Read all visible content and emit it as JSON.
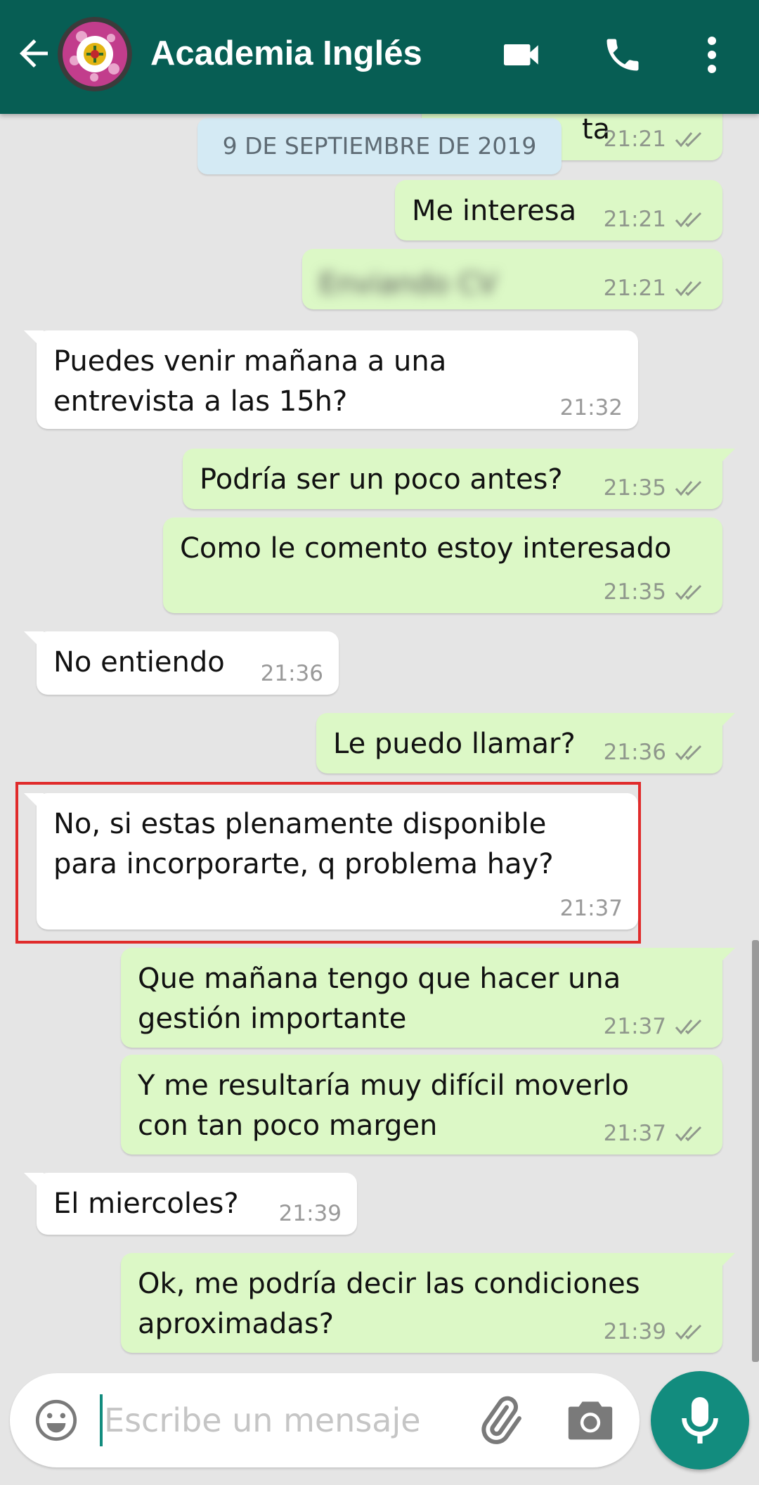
{
  "header": {
    "title": "Academia Inglés",
    "avatar_icon": "academy-logo-icon",
    "background_color": "#075e54"
  },
  "date_chip": "9 DE SEPTIEMBRE DE 2019",
  "messages": [
    {
      "direction": "out",
      "text": "ta",
      "time": "21:21",
      "status": "read"
    },
    {
      "direction": "out",
      "text": "Me interesa",
      "time": "21:21",
      "status": "read"
    },
    {
      "direction": "out",
      "text": "Enviando CV",
      "time": "21:21",
      "status": "read",
      "blurred": true
    },
    {
      "direction": "in",
      "lines": [
        "Puedes venir mañana a una",
        "entrevista a las 15h?"
      ],
      "time": "21:32"
    },
    {
      "direction": "out",
      "text": "Podría ser un poco antes?",
      "time": "21:35",
      "status": "read"
    },
    {
      "direction": "out",
      "text": "Como le comento estoy interesado",
      "time": "21:35",
      "status": "read"
    },
    {
      "direction": "in",
      "text": "No entiendo",
      "time": "21:36"
    },
    {
      "direction": "out",
      "text": "Le puedo llamar?",
      "time": "21:36",
      "status": "read"
    },
    {
      "direction": "in",
      "lines": [
        "No, si estas plenamente disponible",
        "para incorporarte, q problema hay?"
      ],
      "time": "21:37",
      "highlighted": true
    },
    {
      "direction": "out",
      "lines": [
        "Que mañana tengo que hacer una",
        "gestión importante"
      ],
      "time": "21:37",
      "status": "read"
    },
    {
      "direction": "out",
      "lines": [
        "Y me resultaría muy difícil moverlo",
        "con tan poco margen"
      ],
      "time": "21:37",
      "status": "read"
    },
    {
      "direction": "in",
      "text": "El miercoles?",
      "time": "21:39"
    },
    {
      "direction": "out",
      "lines": [
        "Ok, me podría decir las condiciones",
        "aproximadas?"
      ],
      "time": "21:39",
      "status": "read"
    }
  ],
  "input": {
    "placeholder": "Escribe un mensaje",
    "value": ""
  },
  "colors": {
    "incoming_bubble": "#ffffff",
    "outgoing_bubble": "#dcf8c6",
    "highlight": "#e02b2b",
    "mic_button": "#128c7e",
    "read_ticks": "#8f978c"
  }
}
